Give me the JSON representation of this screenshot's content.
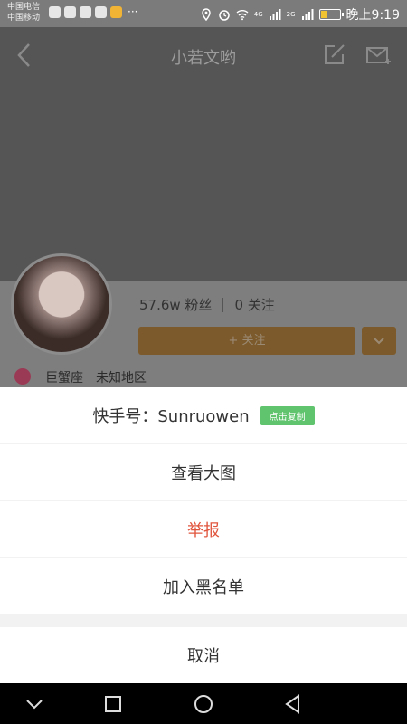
{
  "status_bar": {
    "carrier_1": "中国电信",
    "carrier_2": "中国移动",
    "overflow": "···",
    "net_1": "4G",
    "net_2": "2G",
    "battery_level": 0.3,
    "time": "晚上9:19"
  },
  "header": {
    "title": "小若文哟"
  },
  "profile": {
    "fans": "57.6w 粉丝",
    "following": "0 关注",
    "follow_label": "+ 关注",
    "zodiac": "巨蟹座",
    "region": "未知地区"
  },
  "sheet": {
    "id_label": "快手号：Sunruowen",
    "copy_label": "点击复制",
    "view_large": "查看大图",
    "report": "举报",
    "blacklist": "加入黑名单",
    "cancel": "取消"
  },
  "colors": {
    "accent_report": "#e0553e",
    "copy_badge": "#5fc46d",
    "follow_btn": "#7d5a2b"
  }
}
